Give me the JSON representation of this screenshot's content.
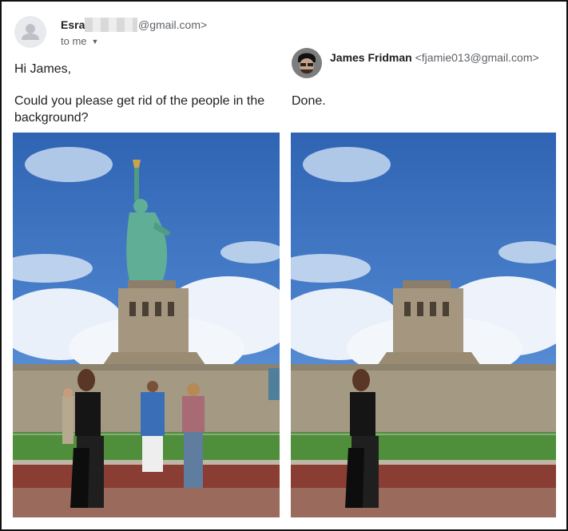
{
  "left_message": {
    "sender_name": "Esra",
    "sender_email_domain": "@gmail.com>",
    "recipient": "to me",
    "greeting": "Hi James,",
    "body": "Could you please get rid of the people in the background?",
    "icons": {
      "avatar": "person-avatar-icon",
      "expand": "chevron-down-icon"
    }
  },
  "right_message": {
    "sender_name": "James Fridman",
    "sender_email": "<fjamie013@gmail.com>",
    "body": "Done."
  },
  "photos": {
    "before": "statue of liberty with people in background",
    "after": "pedestal only, people removed"
  },
  "colors": {
    "sky": "#3f78c4",
    "statue": "#5fae95",
    "frame": "#111111",
    "link_gray": "#5f6368"
  }
}
